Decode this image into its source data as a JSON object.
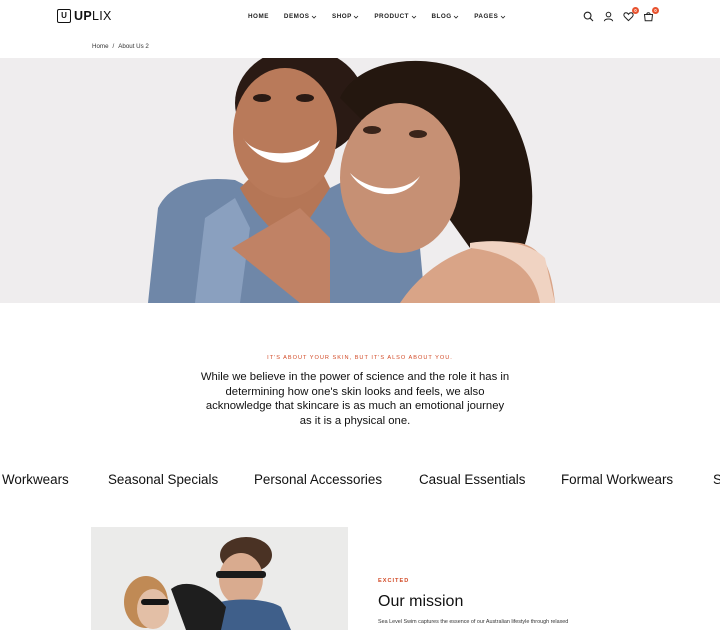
{
  "brand": {
    "logo_letter": "U",
    "logo_bold": "UP",
    "logo_light": "LIX"
  },
  "nav": [
    {
      "label": "HOME"
    },
    {
      "label": "DEMOS"
    },
    {
      "label": "SHOP"
    },
    {
      "label": "PRODUCT"
    },
    {
      "label": "BLOG"
    },
    {
      "label": "PAGES"
    }
  ],
  "header_icons": {
    "search": "search-icon",
    "account": "user-icon",
    "wishlist": "heart-icon",
    "wishlist_count": "0",
    "cart": "cart-icon",
    "cart_count": "0"
  },
  "breadcrumb": {
    "home": "Home",
    "separator": "/",
    "current": "About Us 2"
  },
  "intro": {
    "eyebrow": "IT'S ABOUT YOUR SKIN, BUT IT'S ALSO ABOUT YOU.",
    "text": "While we believe in the power of science and the role it has in determining how one's skin looks and feels, we also acknowledge that skincare is as much an emotional journey as it is a physical one."
  },
  "marquee": [
    "Workwears",
    "Seasonal Specials",
    "Personal Accessories",
    "Casual Essentials",
    "Formal Workwears",
    "S"
  ],
  "mission": {
    "eyebrow": "EXCITED",
    "title": "Our mission",
    "description": "Sea Level Swim captures the essence of our Australian lifestyle through relaxed"
  },
  "colors": {
    "accent": "#d24a26",
    "badge": "#e8522e",
    "hero_bg": "#f0eeef"
  }
}
